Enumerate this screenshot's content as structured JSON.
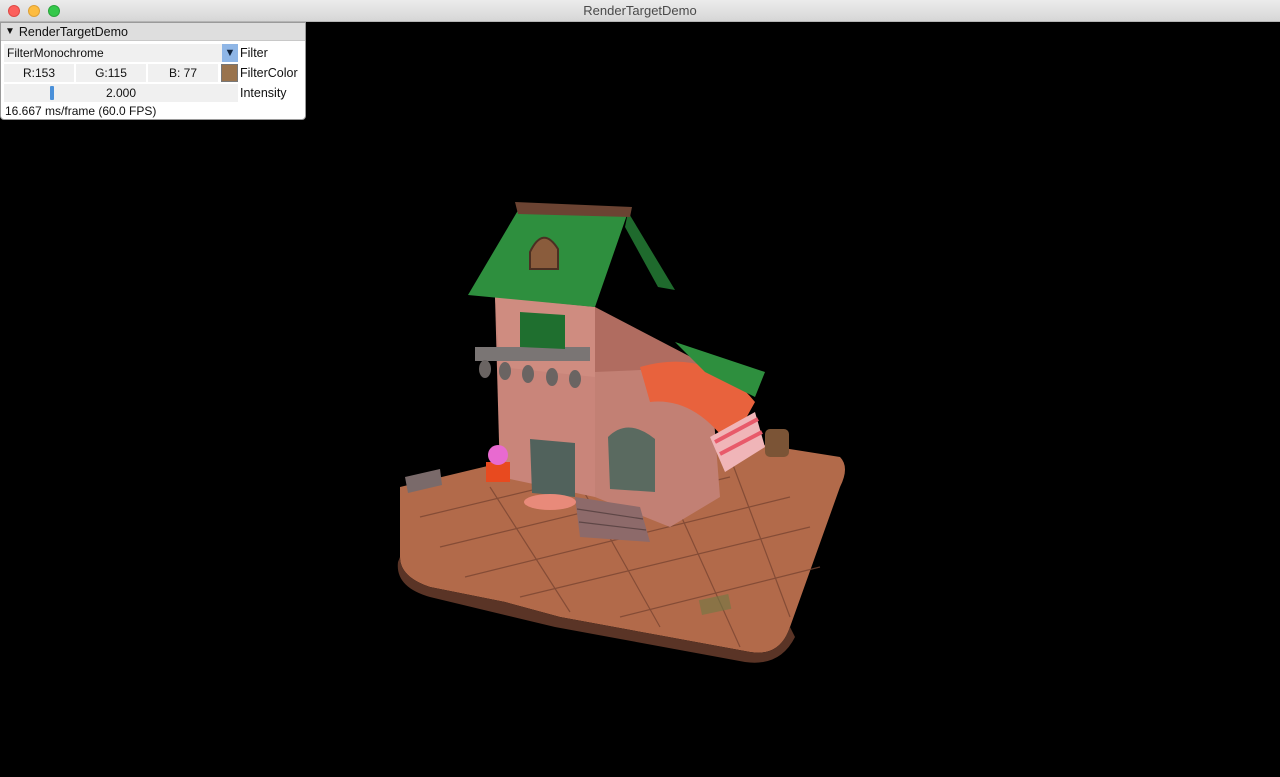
{
  "window": {
    "title": "RenderTargetDemo"
  },
  "panel": {
    "title": "RenderTargetDemo",
    "filter": {
      "value": "FilterMonochrome",
      "label": "Filter"
    },
    "filter_color": {
      "r": "R:153",
      "g": "G:115",
      "b": "B: 77",
      "label": "FilterColor",
      "swatch": "#99734d"
    },
    "intensity": {
      "value": "2.000",
      "label": "Intensity",
      "level": 0.2
    },
    "fps_text": "16.667 ms/frame (60.0 FPS)"
  },
  "icons": {
    "collapse": "collapse-triangle-icon",
    "combo_arrow": "dropdown-arrow-icon"
  }
}
